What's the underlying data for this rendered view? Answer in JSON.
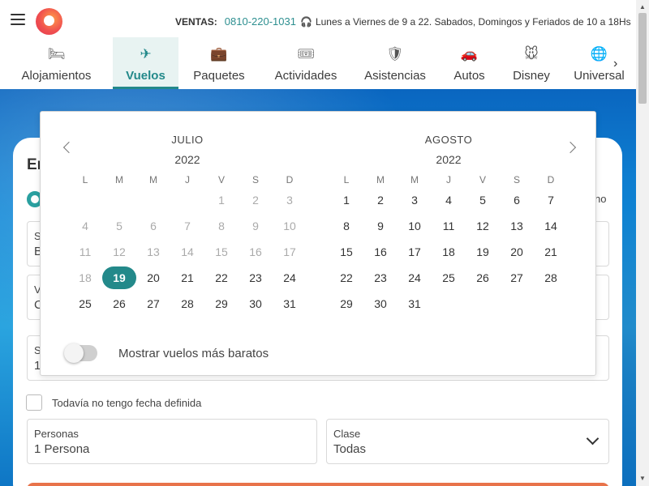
{
  "header": {
    "sales_label": "VENTAS:",
    "phone": "0810-220-1031",
    "hours": "Lunes a Viernes de 9 a 22. Sabados, Domingos y Feriados de 10 a 18Hs"
  },
  "nav": {
    "tabs": [
      {
        "label": "Alojamientos",
        "icon": "bed-icon",
        "glyph": "🛏"
      },
      {
        "label": "Vuelos",
        "icon": "airplane-icon",
        "glyph": "✈",
        "active": true
      },
      {
        "label": "Paquetes",
        "icon": "suitcase-icon",
        "glyph": "💼"
      },
      {
        "label": "Actividades",
        "icon": "ticket-icon",
        "glyph": "🎟"
      },
      {
        "label": "Asistencias",
        "icon": "shield-icon",
        "glyph": "🛡"
      },
      {
        "label": "Autos",
        "icon": "car-icon",
        "glyph": "🚗"
      },
      {
        "label": "Disney",
        "icon": "mickey-icon",
        "glyph": "🐭"
      },
      {
        "label": "Universal",
        "icon": "universal-globe-icon",
        "glyph": "🌐"
      }
    ]
  },
  "form": {
    "title": "En",
    "oneway_partial": "no",
    "origin": {
      "label": "S",
      "value": "B"
    },
    "destination": {
      "label": "V",
      "value": "C"
    },
    "date": {
      "label": "S",
      "value": "19"
    },
    "no_date_label": "Todavía no tengo fecha definida",
    "persons": {
      "label": "Personas",
      "value": "1 Persona"
    },
    "class": {
      "label": "Clase",
      "value": "Todas"
    }
  },
  "calendar": {
    "weekdays": [
      "L",
      "M",
      "M",
      "J",
      "V",
      "S",
      "D"
    ],
    "months": [
      {
        "name": "JULIO",
        "year": "2022",
        "offset": 4,
        "days": 31,
        "past_until": 18,
        "selected": 19
      },
      {
        "name": "AGOSTO",
        "year": "2022",
        "offset": 0,
        "days": 31,
        "past_until": 0,
        "selected": 0
      }
    ],
    "toggle_label": "Mostrar vuelos más baratos",
    "toggle_on": false
  },
  "colors": {
    "accent": "#23898a",
    "cta": "#e8734a"
  }
}
